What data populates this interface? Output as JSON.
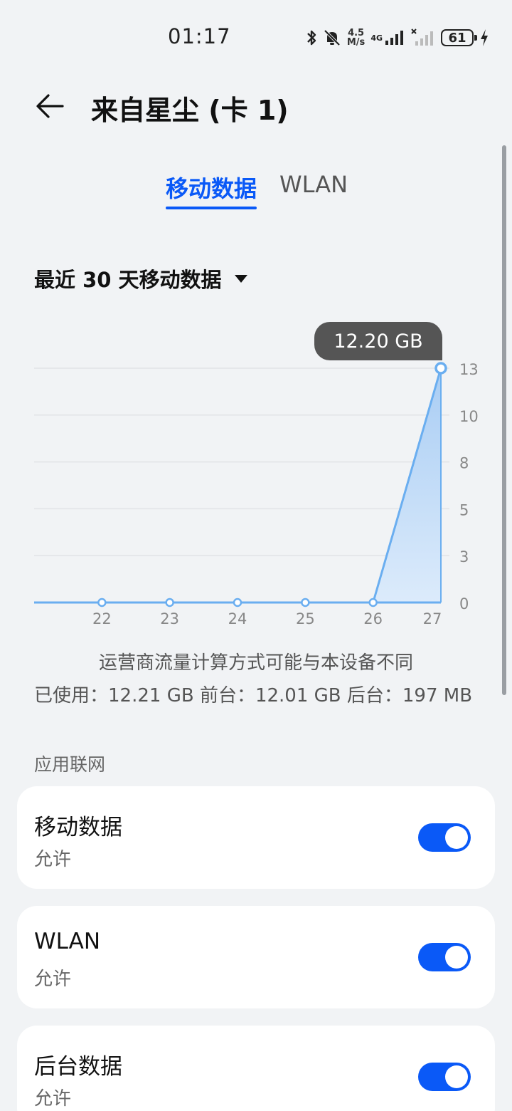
{
  "status_bar": {
    "time": "01:17",
    "net_speed_value": "4.5",
    "net_speed_unit": "M/s",
    "network_type": "4G",
    "battery_level": "61",
    "icons": [
      "bluetooth-icon",
      "mute-bell-icon",
      "signal-icon",
      "no-signal-icon",
      "battery-icon",
      "charging-icon"
    ]
  },
  "header": {
    "title": "来自星尘 (卡 1)"
  },
  "tabs": [
    {
      "label": "移动数据",
      "active": true
    },
    {
      "label": "WLAN",
      "active": false
    }
  ],
  "range": {
    "label": "最近 30 天移动数据"
  },
  "chart_data": {
    "type": "area",
    "x": [
      21,
      22,
      23,
      24,
      25,
      26,
      27
    ],
    "tick_labels_x": [
      "22",
      "23",
      "24",
      "25",
      "26",
      "27"
    ],
    "values": [
      0,
      0,
      0,
      0,
      0,
      0,
      13
    ],
    "ytick_labels": [
      "13",
      "10",
      "8",
      "5",
      "3",
      "0"
    ],
    "ylim": [
      0,
      13
    ],
    "tooltip": "12.20 GB",
    "grid": true,
    "accent_color": "#6aaef0"
  },
  "note": "运营商流量计算方式可能与本设备不同",
  "usage": "已使用：12.21 GB 前台：12.01 GB 后台：197 MB",
  "section": {
    "label": "应用联网"
  },
  "cards": [
    {
      "title": "移动数据",
      "subtitle": "允许",
      "enabled": true
    },
    {
      "title": "WLAN",
      "subtitle": "允许",
      "enabled": true
    },
    {
      "title": "后台数据",
      "subtitle": "允许",
      "enabled": true
    }
  ],
  "colors": {
    "accent": "#0a59f7",
    "background": "#f1f3f5",
    "card": "#ffffff"
  }
}
